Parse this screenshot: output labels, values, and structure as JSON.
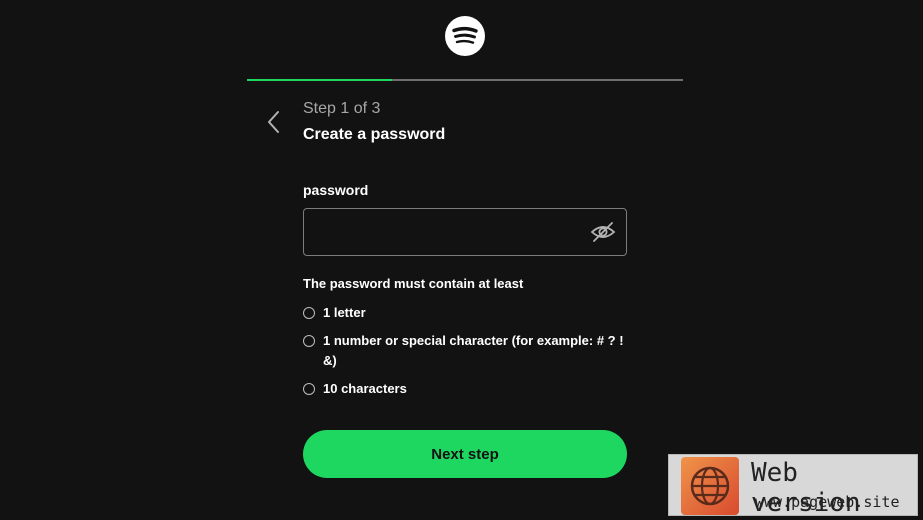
{
  "header": {
    "logo_icon": "spotify-logo-icon",
    "progress_fraction": 0.333,
    "accent_color": "#1ed760"
  },
  "step": {
    "label": "Step 1 of 3",
    "title": "Create a password"
  },
  "password_field": {
    "label": "password",
    "value": "",
    "visibility_icon": "eye-slash-icon"
  },
  "requirements": {
    "title": "The password must contain at least",
    "items": [
      {
        "label": "1 letter",
        "met": false
      },
      {
        "label": "1 number or special character (for example: # ? ! &)",
        "met": false
      },
      {
        "label": "10 characters",
        "met": false
      }
    ]
  },
  "actions": {
    "next_label": "Next step"
  },
  "watermark": {
    "title": "Web version",
    "url": "www.pageweb.site",
    "icon": "globe-icon"
  }
}
